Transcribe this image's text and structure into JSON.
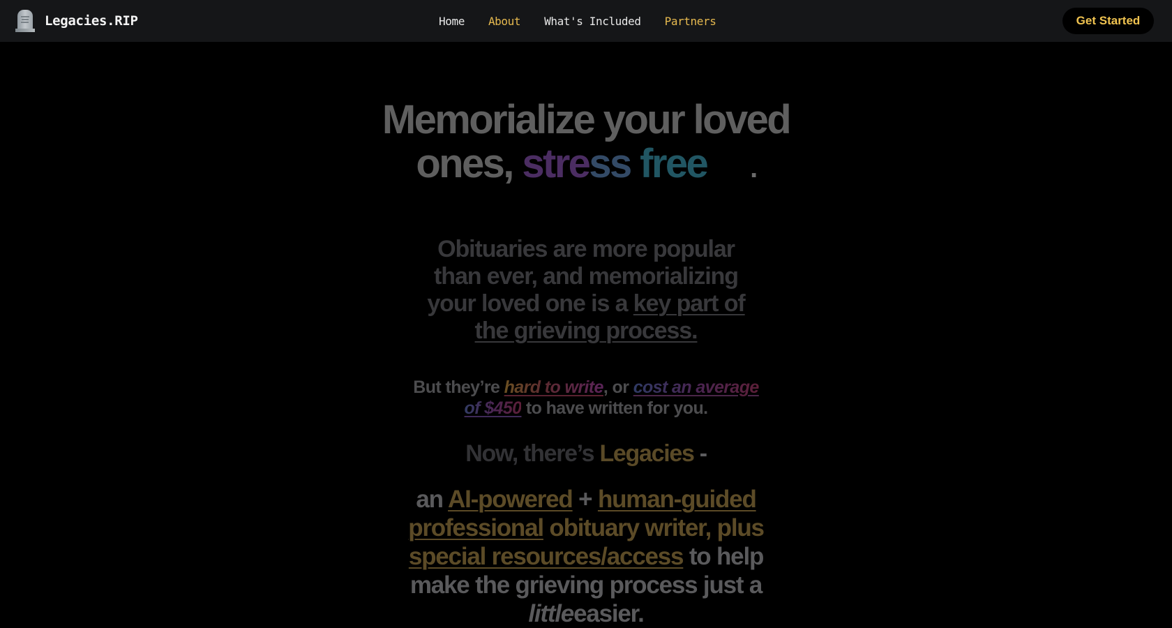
{
  "navbar": {
    "brand_icon": "headstone-icon",
    "brand_name": "Legacies.RIP",
    "links": [
      {
        "label": "Home",
        "highlight": false
      },
      {
        "label": "About",
        "highlight": true
      },
      {
        "label": "What's Included",
        "highlight": false
      },
      {
        "label": "Partners",
        "highlight": true
      }
    ],
    "cta_label": "Get Started"
  },
  "hero": {
    "headline": {
      "line1": "Memorialize your loved",
      "prefix": "ones,",
      "gradient_words": [
        "stre",
        "ss",
        "free"
      ],
      "suffix": "."
    },
    "paragraph1": {
      "text": "Obituaries are more popular than ever, and memorializing your loved one is a",
      "link": "key part of the grieving process."
    },
    "paragraph2": {
      "start": "But they’re",
      "link1": "hard to write",
      "middle": ", or",
      "link2a": "cost an average",
      "link2b": "of $450",
      "end": "to have written for you."
    },
    "paragraph3": {
      "start": "Now, there’s",
      "brand": "Legacies",
      "dash": "-"
    },
    "paragraph4": {
      "an": "an",
      "link1": "AI-powered",
      "plus_sign": "+",
      "link2": "human-guided professional",
      "text1": "obituary writer,",
      "plus": "plus",
      "link3": "special resources/access",
      "text2": "to help make the grieving process just a",
      "emph": "little",
      "text3": "easier."
    }
  },
  "colors": {
    "navbar_bg": "#151618",
    "page_bg": "#000000",
    "accent_gold": "#e6b94f",
    "cta_text": "#f0c350"
  }
}
